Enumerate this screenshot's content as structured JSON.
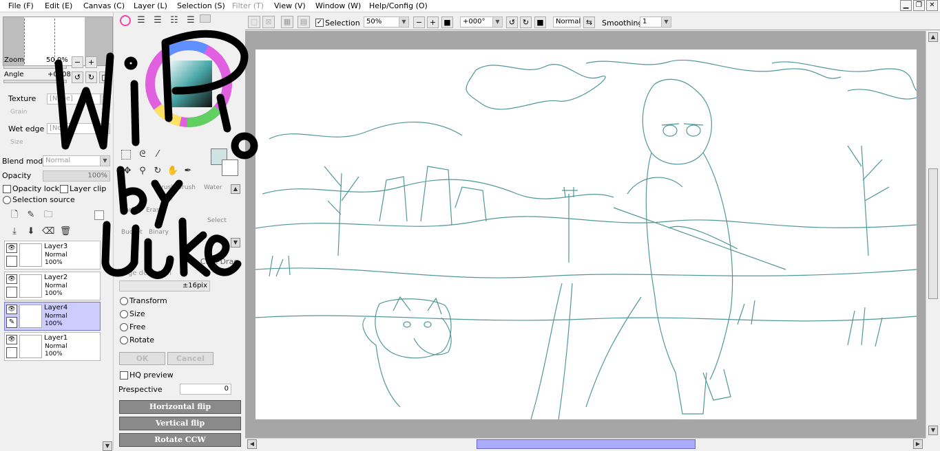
{
  "menu": [
    "File (F)",
    "Edit (E)",
    "Canvas (C)",
    "Layer (L)",
    "Selection (S)",
    "Filter (T)",
    "View (V)",
    "Window (W)",
    "Help/Config (O)"
  ],
  "left": {
    "zoom_label": "Zoom",
    "zoom_value": "50.0%",
    "angle_label": "Angle",
    "angle_value": "+0008",
    "texture_label": "Texture",
    "texture_value": "[None]",
    "grain_label": "Grain",
    "grain_value": "20",
    "wet_edge_label": "Wet edge",
    "wet_edge_value": "[None]",
    "size_label": "Size",
    "blend_mode_label": "Blend mode",
    "blend_mode_value": "Normal",
    "opacity_label": "Opacity",
    "opacity_value": "100%",
    "opacity_lock": "Opacity lock",
    "layer_clip": "Layer clip",
    "selection_source": "Selection source",
    "layers": [
      {
        "name": "Layer3",
        "mode": "Normal",
        "opacity": "100%"
      },
      {
        "name": "Layer2",
        "mode": "Normal",
        "opacity": "100%"
      },
      {
        "name": "Layer4",
        "mode": "Normal",
        "opacity": "100%"
      },
      {
        "name": "Layer1",
        "mode": "Normal",
        "opacity": "100%"
      }
    ]
  },
  "mid": {
    "tool_labels": [
      "Brush",
      "Brush",
      "Water",
      "Marker",
      "Eraser",
      "Select",
      "Bucket",
      "Binary"
    ],
    "ctrl_drag": "th Ctrl+Drag",
    "edge_detection": "ge detection",
    "pix_value": "±16pix",
    "transform": "Transform",
    "size": "Size",
    "free": "Free",
    "rotate": "Rotate",
    "ok": "OK",
    "cancel": "Cancel",
    "hq_preview": "HQ preview",
    "prespective": "Prespective",
    "prespective_value": "0",
    "horizontal_flip": "Horizontal flip",
    "vertical_flip": "Vertical flip",
    "rotate_ccw": "Rotate CCW"
  },
  "toolbar": {
    "selection": "Selection",
    "zoom": "50%",
    "angle": "+000°",
    "mode": "Normal",
    "smoothing_label": "Smoothing",
    "smoothing_value": "1"
  },
  "watermark": "WIP by Uuke",
  "colors": {
    "accent": "#f28c3a",
    "sketch": "#3d8c8c",
    "layer_selected": "#ccccff",
    "hscroll_thumb": "#aaaaff"
  }
}
